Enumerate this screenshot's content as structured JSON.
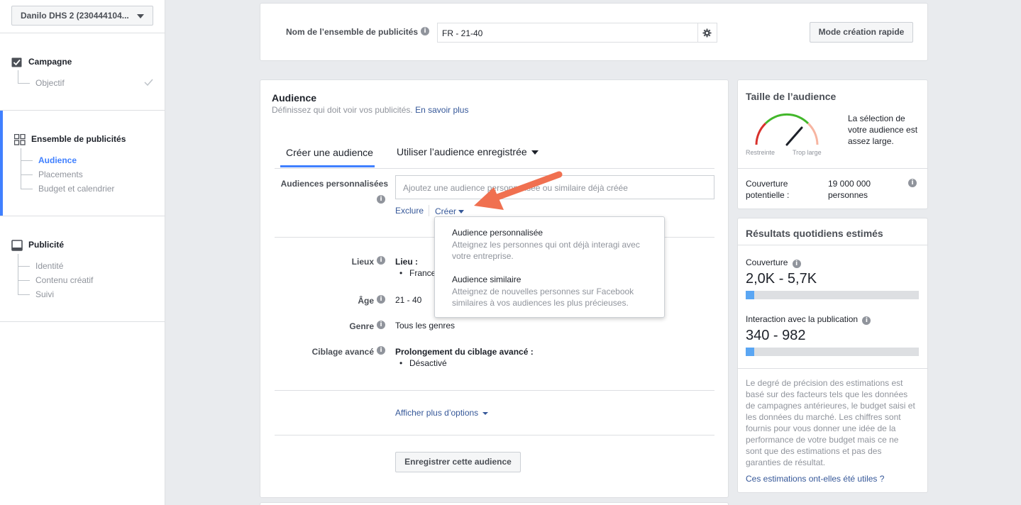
{
  "sidebar": {
    "account": "Danilo DHS 2 (230444104...",
    "campaign": {
      "title": "Campagne",
      "items": [
        "Objectif"
      ]
    },
    "adset": {
      "title": "Ensemble de publicités",
      "items": [
        "Audience",
        "Placements",
        "Budget et calendrier"
      ]
    },
    "ad": {
      "title": "Publicité",
      "items": [
        "Identité",
        "Contenu créatif",
        "Suivi"
      ]
    }
  },
  "adset_name": {
    "label": "Nom de l’ensemble de publicités",
    "value": "FR - 21-40",
    "quick_mode": "Mode création rapide"
  },
  "audience": {
    "title": "Audience",
    "subtitle": "Définissez qui doit voir vos publicités.",
    "learn_more": "En savoir plus",
    "tab_create": "Créer une audience",
    "tab_saved": "Utiliser l’audience enregistrée",
    "custom_label": "Audiences personnalisées",
    "custom_placeholder": "Ajoutez une audience personnalisée ou similaire déjà créée",
    "exclude": "Exclure",
    "create": "Créer",
    "locations_label": "Lieux",
    "location_heading": "Lieu :",
    "location_value": "France",
    "age_label": "Âge",
    "age_value": "21 - 40",
    "gender_label": "Genre",
    "gender_value": "Tous les genres",
    "advanced_label": "Ciblage avancé",
    "advanced_heading": "Prolongement du ciblage avancé :",
    "advanced_value": "Désactivé",
    "more_options": "Afficher plus d’options",
    "save_button": "Enregistrer cette audience"
  },
  "dropdown": {
    "items": [
      {
        "title": "Audience personnalisée",
        "desc1": "Atteignez les personnes qui ont déjà interagi avec",
        "desc2": "votre entreprise."
      },
      {
        "title": "Audience similaire",
        "desc1": "Atteignez de nouvelles personnes sur Facebook",
        "desc2": "similaires à vos audiences les plus précieuses."
      }
    ]
  },
  "audience_size": {
    "title": "Taille de l’audience",
    "gauge_left": "Restreinte",
    "gauge_right": "Trop large",
    "desc_lines": [
      "La sélection de",
      "votre audience est",
      "assez large."
    ],
    "reach_label_1": "Couverture",
    "reach_label_2": "potentielle :",
    "reach_value_1": "19 000 000",
    "reach_value_2": "personnes"
  },
  "daily": {
    "title": "Résultats quotidiens estimés",
    "reach_label": "Couverture",
    "reach_value": "2,0K - 5,7K",
    "reach_fill": 0.05,
    "engagement_label": "Interaction avec la publication",
    "engagement_value": "340 - 982",
    "engagement_fill": 0.05,
    "disclaimer_lines": [
      "Le degré de précision des estimations est",
      "basé sur des facteurs tels que les données",
      "de campagnes antérieures, le budget saisi et",
      "les données du marché. Les chiffres sont",
      "fournis pour vous donner une idée de la",
      "performance de votre budget mais ce ne",
      "sont que des estimations et pas des",
      "garanties de résultat."
    ],
    "feedback_link": "Ces estimations ont-elles été utiles ?"
  },
  "colors": {
    "accent": "#4080ff",
    "link": "#365899",
    "arrow": "#f07050",
    "bar": "#5aa6f3"
  }
}
